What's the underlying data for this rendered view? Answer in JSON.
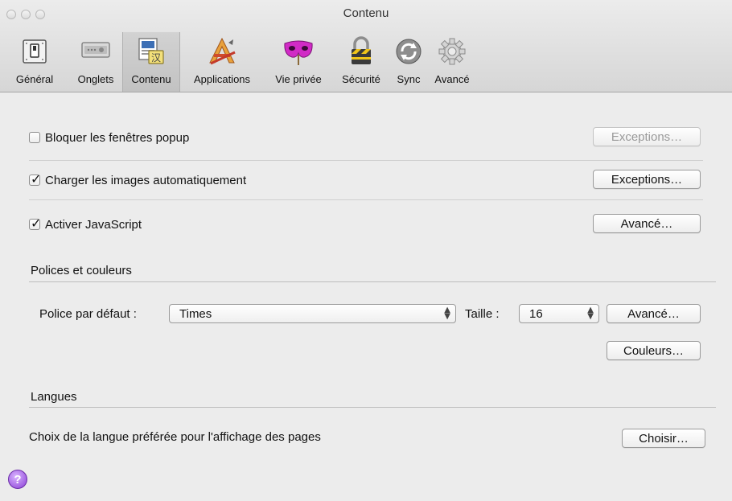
{
  "window": {
    "title": "Contenu"
  },
  "toolbar": {
    "tabs": [
      {
        "label": "Général",
        "icon": "switch-icon"
      },
      {
        "label": "Onglets",
        "icon": "tabs-icon"
      },
      {
        "label": "Contenu",
        "icon": "content-icon"
      },
      {
        "label": "Applications",
        "icon": "applications-icon"
      },
      {
        "label": "Vie privée",
        "icon": "privacy-mask-icon"
      },
      {
        "label": "Sécurité",
        "icon": "lock-icon"
      },
      {
        "label": "Sync",
        "icon": "sync-icon"
      },
      {
        "label": "Avancé",
        "icon": "gear-icon"
      }
    ],
    "active_tab": "Contenu"
  },
  "content": {
    "popup": {
      "label": "Bloquer les fenêtres popup",
      "checked": false,
      "button": "Exceptions…",
      "button_enabled": false
    },
    "images": {
      "label": "Charger les images automatiquement",
      "checked": true,
      "button": "Exceptions…"
    },
    "javascript": {
      "label": "Activer JavaScript",
      "checked": true,
      "button": "Avancé…"
    },
    "fonts": {
      "section_title": "Polices et couleurs",
      "default_font_label": "Police par défaut :",
      "default_font_value": "Times",
      "size_label": "Taille :",
      "size_value": "16",
      "advanced_button": "Avancé…",
      "colors_button": "Couleurs…"
    },
    "languages": {
      "section_title": "Langues",
      "description": "Choix de la langue préférée pour l'affichage des pages",
      "choose_button": "Choisir…"
    },
    "help": {
      "symbol": "?"
    }
  },
  "colors": {
    "help_purple": "#8a3fd6",
    "mask_magenta": "#d12bc6"
  }
}
